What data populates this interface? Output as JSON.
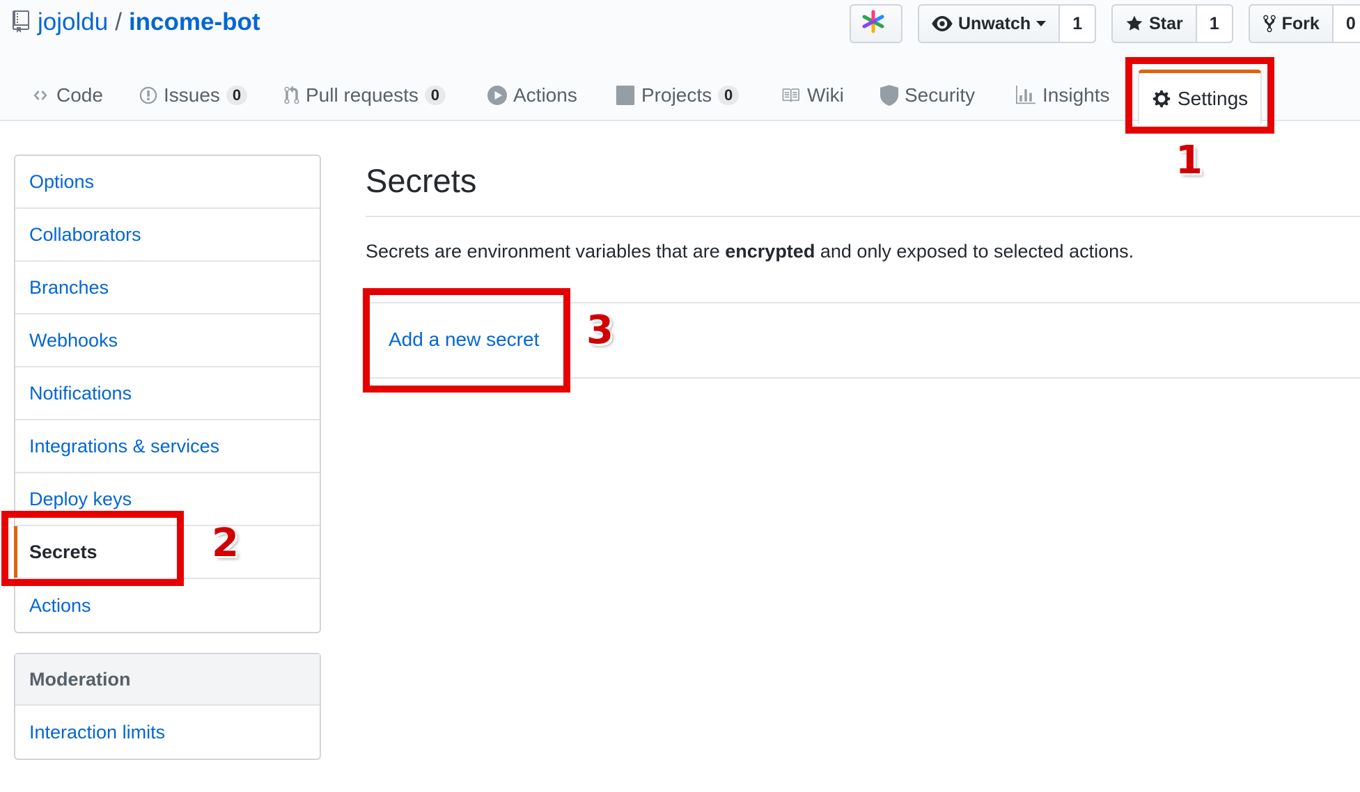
{
  "repo": {
    "owner": "jojoldu",
    "separator": "/",
    "name": "income-bot"
  },
  "actions": {
    "watch": {
      "label": "Unwatch",
      "count": "1"
    },
    "star": {
      "label": "Star",
      "count": "1"
    },
    "fork": {
      "label": "Fork",
      "count": "0"
    }
  },
  "nav": {
    "tabs": [
      {
        "label": "Code",
        "icon": "code-icon"
      },
      {
        "label": "Issues",
        "icon": "issue-opened-icon",
        "count": "0"
      },
      {
        "label": "Pull requests",
        "icon": "git-pull-request-icon",
        "count": "0"
      },
      {
        "label": "Actions",
        "icon": "play-icon"
      },
      {
        "label": "Projects",
        "icon": "project-icon",
        "count": "0"
      },
      {
        "label": "Wiki",
        "icon": "book-icon"
      },
      {
        "label": "Security",
        "icon": "shield-icon"
      },
      {
        "label": "Insights",
        "icon": "graph-icon"
      },
      {
        "label": "Settings",
        "icon": "gear-icon",
        "selected": true
      }
    ]
  },
  "sidebar": {
    "items": [
      {
        "label": "Options"
      },
      {
        "label": "Collaborators"
      },
      {
        "label": "Branches"
      },
      {
        "label": "Webhooks"
      },
      {
        "label": "Notifications"
      },
      {
        "label": "Integrations & services"
      },
      {
        "label": "Deploy keys"
      },
      {
        "label": "Secrets",
        "selected": true
      },
      {
        "label": "Actions"
      }
    ],
    "moderation": {
      "heading": "Moderation",
      "items": [
        {
          "label": "Interaction limits"
        }
      ]
    }
  },
  "main": {
    "title": "Secrets",
    "description": {
      "before": "Secrets are environment variables that are ",
      "bold": "encrypted",
      "after": " and only exposed to selected actions."
    },
    "add_link": "Add a new secret"
  },
  "annotations": {
    "color": "#e60000",
    "step1": "1",
    "step2": "2",
    "step3": "3"
  }
}
